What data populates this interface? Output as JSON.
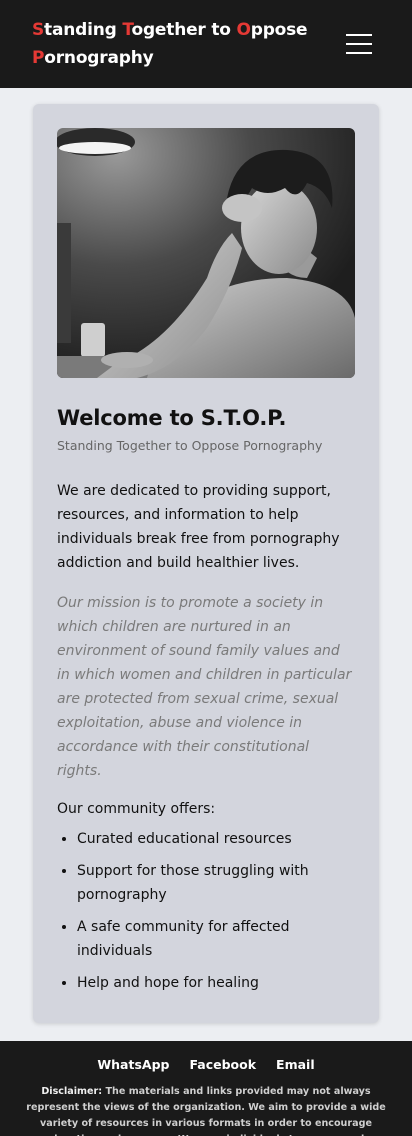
{
  "header": {
    "brand_parts": [
      {
        "hl": "S",
        "rest": "tanding "
      },
      {
        "hl": "T",
        "rest": "ogether to "
      },
      {
        "hl": "O",
        "rest": "ppose"
      },
      {
        "hl": "P",
        "rest": "ornography"
      }
    ]
  },
  "main": {
    "title": "Welcome to S.T.O.P.",
    "subtitle": "Standing Together to Oppose Pornography",
    "intro": "We are dedicated to providing support, resources, and information to help individuals break free from pornography addiction and build healthier lives.",
    "mission": "Our mission is to promote a society in which children are nurtured in an environment of sound family values and in which women and children in particular are protected from sexual crime, sexual exploitation, abuse and violence in accordance with their constitutional rights.",
    "offers_heading": "Our community offers:",
    "offers": [
      "Curated educational resources",
      "Support for those struggling with pornography",
      "A safe community for affected individuals",
      "Help and hope for healing"
    ]
  },
  "footer": {
    "links": [
      "WhatsApp",
      "Facebook",
      "Email"
    ],
    "disclaimer_label": "Disclaimer:",
    "disclaimer_text": "The materials and links provided may not always represent the views of the organization. We aim to provide a wide variety of resources in various formats in order to encourage education and recovery. We urge individuals to assess each resource on its own merit and to use discretion in determining what aligns with their belief systems."
  },
  "colors": {
    "accent": "#e53935",
    "header_bg": "#1a1a1a",
    "card_bg": "#d3d5dd"
  }
}
